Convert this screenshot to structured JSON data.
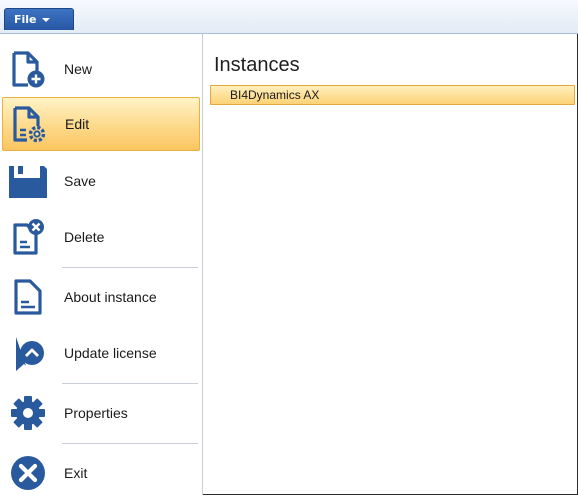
{
  "topbar": {
    "file_label": "File"
  },
  "menu": {
    "items": [
      {
        "label": "New",
        "icon": "new-document-icon"
      },
      {
        "label": "Edit",
        "icon": "edit-document-icon"
      },
      {
        "label": "Save",
        "icon": "save-icon"
      },
      {
        "label": "Delete",
        "icon": "delete-document-icon"
      },
      {
        "label": "About instance",
        "icon": "about-document-icon"
      },
      {
        "label": "Update license",
        "icon": "license-ribbon-icon"
      },
      {
        "label": "Properties",
        "icon": "gear-icon"
      },
      {
        "label": "Exit",
        "icon": "exit-icon"
      }
    ],
    "active_item": "Edit"
  },
  "content": {
    "title": "Instances",
    "instances": [
      {
        "name": "BI4Dynamics AX",
        "selected": true
      }
    ]
  },
  "colors": {
    "icon": "#2a5a9e",
    "accent_highlight": "#fcd277",
    "file_button": "#2f63b3"
  }
}
